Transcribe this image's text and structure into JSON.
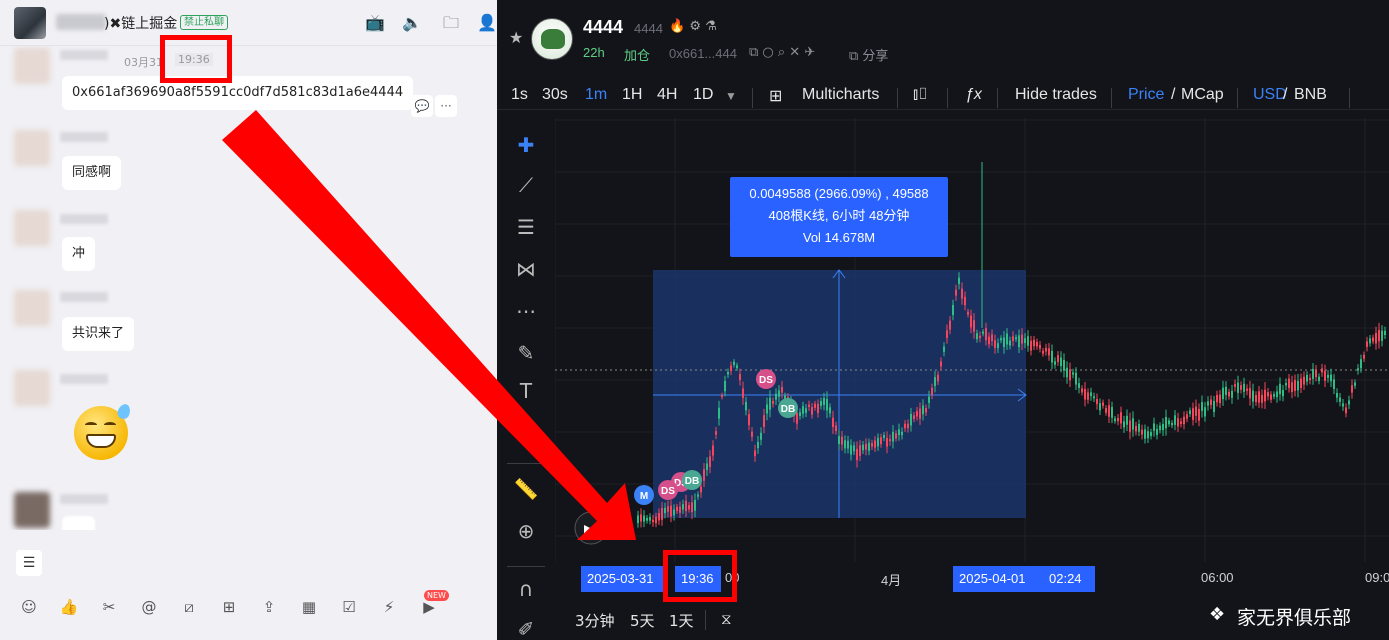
{
  "chat": {
    "title": ")✖链上掘金",
    "badge": "禁止私聊",
    "date": "03月31",
    "time": "19:36",
    "messages": [
      {
        "text": "0x661af369690a8f5591cc0df7d581c83d1a6e4444"
      },
      {
        "text": "同感啊"
      },
      {
        "text": "冲"
      },
      {
        "text": "共识来了"
      },
      {
        "text": "…"
      }
    ],
    "menu_label": "☰"
  },
  "token": {
    "name": "4444",
    "ticker": "4444",
    "age": "22h",
    "add_label": "加仓",
    "address": "0x661...444",
    "share_label": "分享"
  },
  "toolbar": {
    "timeframes": [
      "1s",
      "30s",
      "1m",
      "1H",
      "4H",
      "1D"
    ],
    "active_timeframe": "1m",
    "multicharts": "Multicharts",
    "hide_trades": "Hide trades",
    "price": "Price",
    "mcap": "MCap",
    "usd": "USD",
    "bnb": "BNB",
    "slash": "/"
  },
  "chart_data": {
    "type": "candlestick",
    "tooltip": {
      "line1": "0.0049588 (2966.09%) , 49588",
      "line2": "408根K线, 6小时 48分钟",
      "line3": "Vol 14.678M"
    },
    "x_labels": [
      "2025-03-31",
      "19:36",
      "00",
      "4月",
      "2025-04-01",
      "02:24",
      "06:00",
      "09:0"
    ],
    "markers": [
      "DS",
      "DB",
      "DS",
      "DB",
      "DS",
      "M"
    ]
  },
  "range": {
    "r1": "3分钟",
    "r2": "5天",
    "r3": "1天"
  },
  "watermark": "家无界俱乐部",
  "colors": {
    "up": "#2ebd85",
    "down": "#f6465d",
    "accent": "#2962ff",
    "highlight": "#ff0000"
  }
}
